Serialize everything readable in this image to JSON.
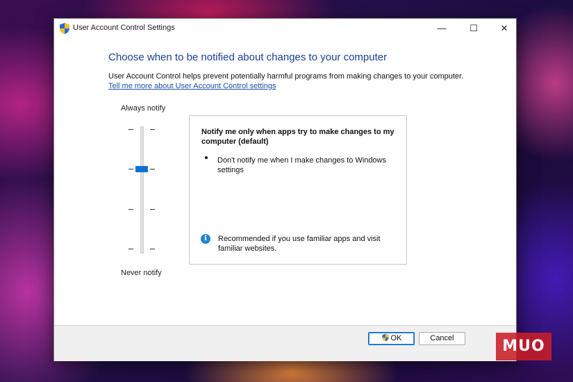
{
  "window": {
    "title": "User Account Control Settings",
    "controls": {
      "minimize": "—",
      "maximize": "☐",
      "close": "✕"
    },
    "icon": "uac-shield-icon"
  },
  "content": {
    "heading": "Choose when to be notified about changes to your computer",
    "description": "User Account Control helps prevent potentially harmful programs from making changes to your computer.",
    "link": "Tell me more about User Account Control settings"
  },
  "slider": {
    "top_label": "Always notify",
    "bottom_label": "Never notify",
    "levels": 4,
    "selected_level": 2,
    "accent_color": "#0a74d4"
  },
  "panel": {
    "title": "Notify me only when apps try to make changes to my computer (default)",
    "bullets": [
      "Don't notify me when I make changes to Windows settings"
    ],
    "info_icon": "i",
    "info_text": "Recommended if you use familiar apps and visit familiar websites."
  },
  "buttons": {
    "ok": "OK",
    "cancel": "Cancel"
  },
  "watermark": "MUO"
}
